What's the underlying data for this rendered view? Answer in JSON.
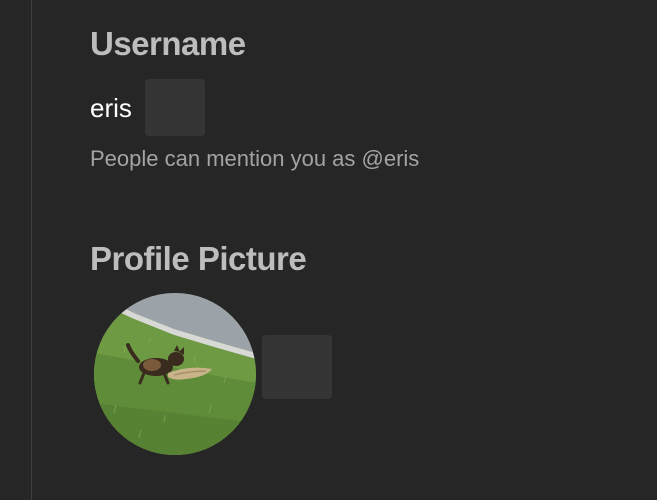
{
  "username_section": {
    "title": "Username",
    "value": "eris",
    "hint": "People can mention you as @eris"
  },
  "profile_picture_section": {
    "title": "Profile Picture",
    "avatar_subject": "dog running on grass"
  },
  "colors": {
    "background": "#262626",
    "title": "#bdbdbd",
    "value": "#ffffff",
    "hint": "#a3a3a3",
    "button": "#353535"
  }
}
